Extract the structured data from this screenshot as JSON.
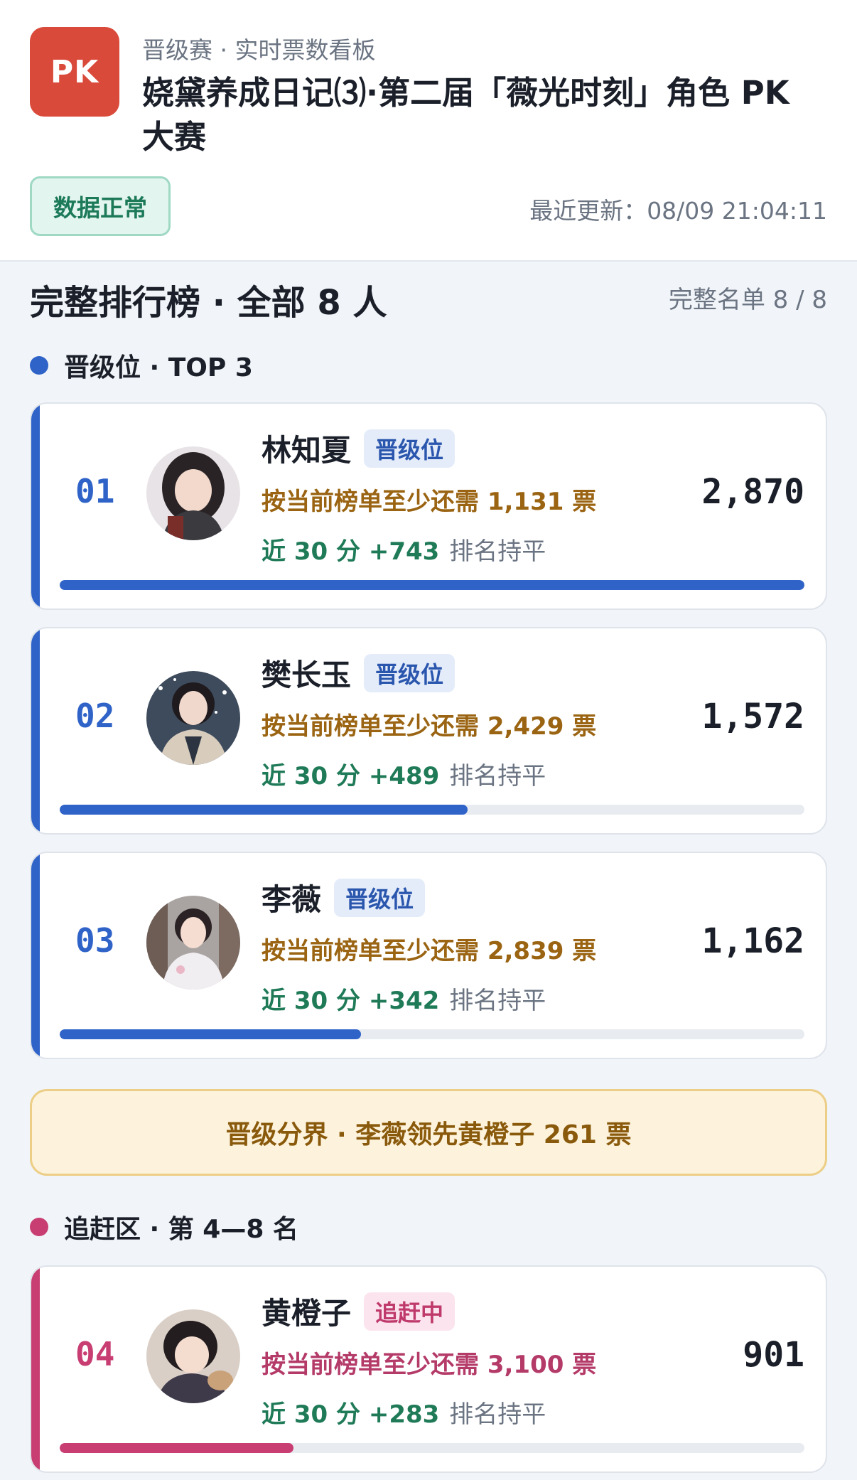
{
  "header": {
    "logo_text": "PK",
    "subtitle": "晋级赛 · 实时票数看板",
    "title": "娆黛养成日记⑶·第二届「薇光时刻」角色 PK 大赛",
    "status": "数据正常",
    "updated": "最近更新：08/09 21:04:11"
  },
  "ranking": {
    "title": "完整排行榜 · 全部 8 人",
    "count": "完整名单 8 / 8"
  },
  "groups": {
    "qualify": {
      "label": "晋级位 · TOP 3",
      "color": "#2f63c8"
    },
    "chase": {
      "label": "追赶区 · 第 4—8 名",
      "color": "#c83e72"
    }
  },
  "entries": [
    {
      "rank": "01",
      "name": "林知夏",
      "tag": "晋级位",
      "need": "按当前榜单至少还需 1,131 票",
      "trend": "近 30 分 +743",
      "trend_status": "排名持平",
      "votes": "2,870",
      "progress": 1.0
    },
    {
      "rank": "02",
      "name": "樊长玉",
      "tag": "晋级位",
      "need": "按当前榜单至少还需 2,429 票",
      "trend": "近 30 分 +489",
      "trend_status": "排名持平",
      "votes": "1,572",
      "progress": 0.548
    },
    {
      "rank": "03",
      "name": "李薇",
      "tag": "晋级位",
      "need": "按当前榜单至少还需 2,839 票",
      "trend": "近 30 分 +342",
      "trend_status": "排名持平",
      "votes": "1,162",
      "progress": 0.405
    },
    {
      "rank": "04",
      "name": "黄橙子",
      "tag": "追赶中",
      "need": "按当前榜单至少还需 3,100 票",
      "trend": "近 30 分 +283",
      "trend_status": "排名持平",
      "votes": "901",
      "progress": 0.314
    }
  ],
  "cutoff": "晋级分界 · 李薇领先黄橙子 261 票"
}
